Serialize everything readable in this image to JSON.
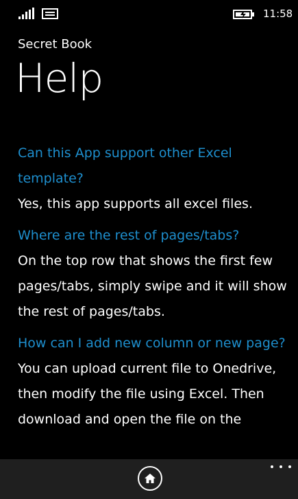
{
  "status_bar": {
    "signal_icon": "signal-bars-icon",
    "message_icon": "message-icon",
    "battery_icon": "battery-charging-icon",
    "time": "11:58"
  },
  "app": {
    "name": "Secret Book"
  },
  "page": {
    "title": "Help"
  },
  "faq": [
    {
      "question": "Can this App support other Excel template?",
      "answer": "Yes, this app supports all excel files."
    },
    {
      "question": "Where are the rest of pages/tabs?",
      "answer": "On the top row that shows the first few pages/tabs, simply swipe and it will show the rest of pages/tabs."
    },
    {
      "question": "How can I add new column or new page?",
      "answer": "You can upload current file to Onedrive, then modify the file using Excel. Then download and open the file on the"
    }
  ],
  "app_bar": {
    "home_icon": "home-icon",
    "more_icon": "more-dots-icon"
  },
  "colors": {
    "background": "#000000",
    "accent": "#1e8fce",
    "text": "#ffffff",
    "app_bar": "#1f1f1f"
  }
}
